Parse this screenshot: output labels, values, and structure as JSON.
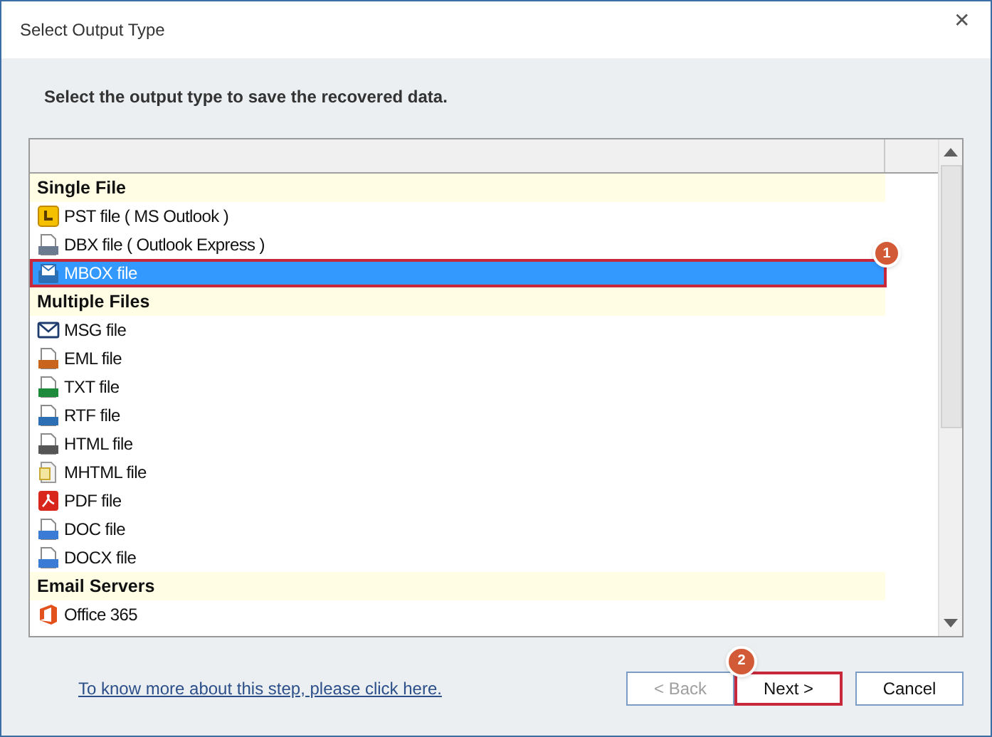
{
  "window": {
    "title": "Select Output Type",
    "close": "✕"
  },
  "instruction": "Select the output type to save the recovered data.",
  "list": {
    "rows": [
      {
        "kind": "group",
        "label": "Single File"
      },
      {
        "kind": "item",
        "label": "PST file ( MS Outlook )",
        "selected": false
      },
      {
        "kind": "item",
        "label": "DBX file ( Outlook Express )",
        "selected": false
      },
      {
        "kind": "item",
        "label": "MBOX file",
        "selected": true,
        "badge": "1"
      },
      {
        "kind": "group",
        "label": "Multiple Files"
      },
      {
        "kind": "item",
        "label": "MSG file",
        "selected": false
      },
      {
        "kind": "item",
        "label": "EML file",
        "selected": false
      },
      {
        "kind": "item",
        "label": "TXT file",
        "selected": false
      },
      {
        "kind": "item",
        "label": "RTF file",
        "selected": false
      },
      {
        "kind": "item",
        "label": "HTML file",
        "selected": false
      },
      {
        "kind": "item",
        "label": "MHTML file",
        "selected": false
      },
      {
        "kind": "item",
        "label": "PDF file",
        "selected": false
      },
      {
        "kind": "item",
        "label": "DOC file",
        "selected": false
      },
      {
        "kind": "item",
        "label": "DOCX file",
        "selected": false
      },
      {
        "kind": "group",
        "label": "Email Servers"
      },
      {
        "kind": "item",
        "label": "Office 365",
        "selected": false
      }
    ]
  },
  "help_link": "To know more about this step, please click here.",
  "buttons": [
    {
      "label": "< Back",
      "disabled": true,
      "highlighted": false
    },
    {
      "label": "Next >",
      "disabled": false,
      "highlighted": true,
      "badge": "2"
    },
    {
      "label": "Cancel",
      "disabled": false,
      "highlighted": false
    }
  ]
}
